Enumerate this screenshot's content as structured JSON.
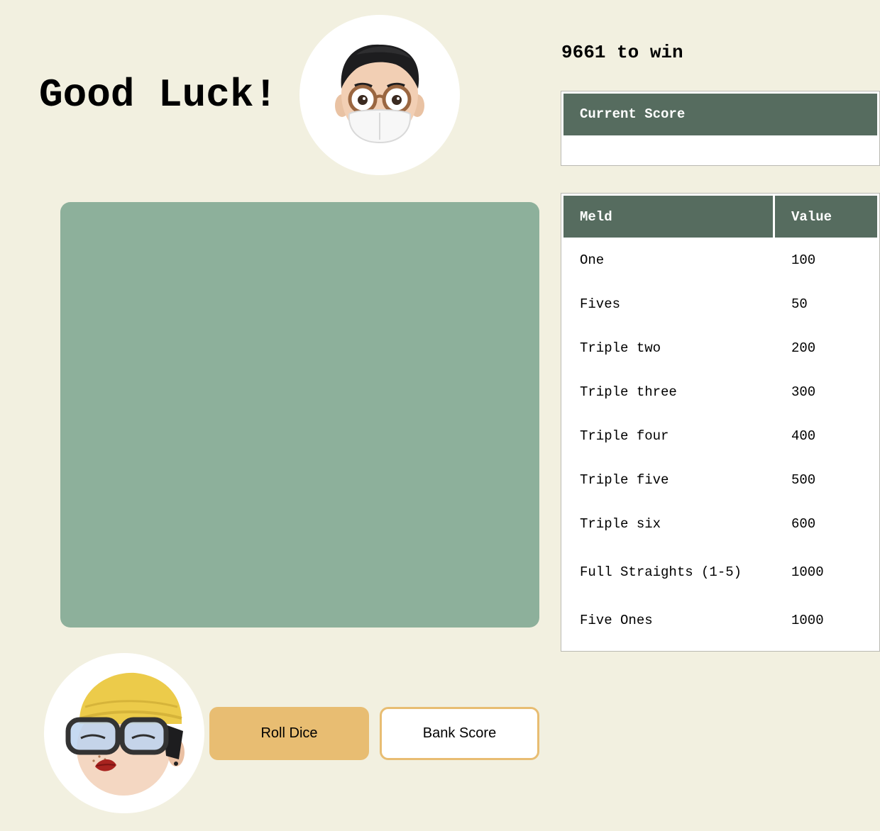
{
  "header": {
    "title": "Good Luck!"
  },
  "status": {
    "target_text": "9661 to win"
  },
  "current_score": {
    "header": "Current Score",
    "value": ""
  },
  "controls": {
    "roll_label": "Roll Dice",
    "bank_label": "Bank Score"
  },
  "meld_table": {
    "headers": [
      "Meld",
      "Value"
    ],
    "rows": [
      {
        "meld": "One",
        "value": "100"
      },
      {
        "meld": "Fives",
        "value": "50"
      },
      {
        "meld": "Triple two",
        "value": "200"
      },
      {
        "meld": "Triple three",
        "value": "300"
      },
      {
        "meld": "Triple four",
        "value": "400"
      },
      {
        "meld": "Triple five",
        "value": "500"
      },
      {
        "meld": "Triple six",
        "value": "600"
      },
      {
        "meld": "Full Straights (1-5)",
        "value": "1000"
      },
      {
        "meld": "Five Ones",
        "value": "1000"
      }
    ]
  },
  "colors": {
    "page_background": "#f2f0e0",
    "board": "#8db09b",
    "table_header": "#566c5f",
    "accent": "#e8bd72"
  },
  "icons": {
    "opponent_avatar": "memoji-glasses-mask",
    "player_avatar": "memoji-beanie-glasses"
  }
}
